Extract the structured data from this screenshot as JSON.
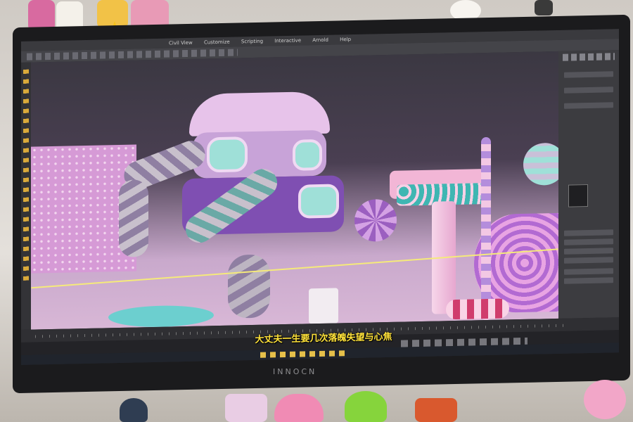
{
  "menu": [
    "Civil View",
    "Customize",
    "Scripting",
    "Interactive",
    "Arnold",
    "Help"
  ],
  "subtitle": "大丈夫一生要几次落魄失望与心焦",
  "monitor_brand": "INNOCN",
  "colors": {
    "accent": "#b98be0",
    "pink": "#f2a9d6",
    "teal": "#3fb6b2",
    "subtitle": "#ffe23a"
  }
}
